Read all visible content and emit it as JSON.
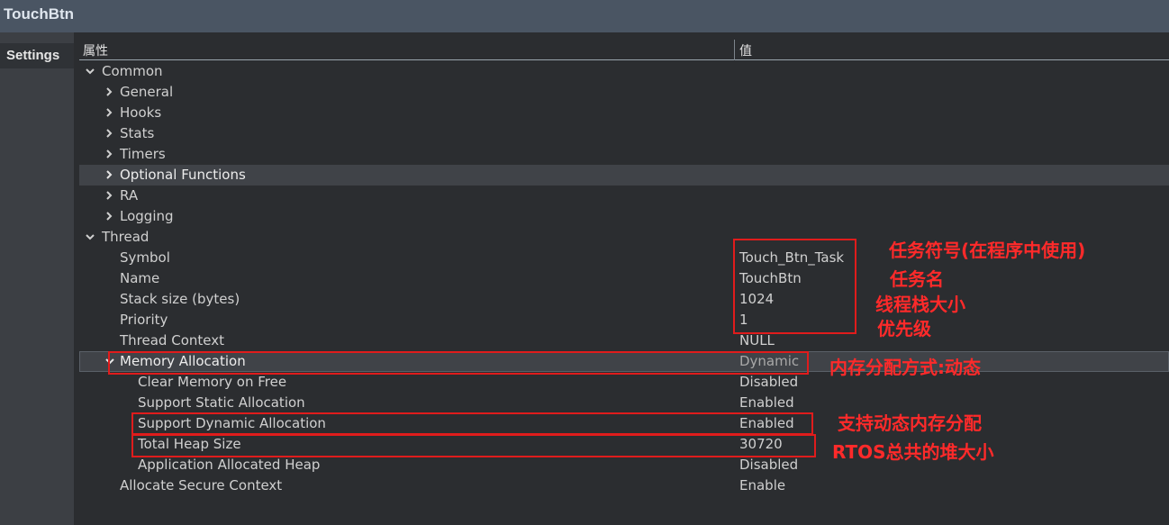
{
  "window": {
    "title": "TouchBtn"
  },
  "sidebar": {
    "tabs": [
      {
        "label": "Settings"
      }
    ]
  },
  "table": {
    "headers": {
      "property": "属性",
      "value": "值"
    },
    "rows": [
      {
        "label": "Common",
        "value": "",
        "expanded": true
      },
      {
        "label": "General",
        "value": ""
      },
      {
        "label": "Hooks",
        "value": ""
      },
      {
        "label": "Stats",
        "value": ""
      },
      {
        "label": "Timers",
        "value": ""
      },
      {
        "label": "Optional Functions",
        "value": ""
      },
      {
        "label": "RA",
        "value": ""
      },
      {
        "label": "Logging",
        "value": ""
      },
      {
        "label": "Thread",
        "value": "",
        "expanded": true
      },
      {
        "label": "Symbol",
        "value": "Touch_Btn_Task"
      },
      {
        "label": "Name",
        "value": "TouchBtn"
      },
      {
        "label": "Stack size (bytes)",
        "value": "1024"
      },
      {
        "label": "Priority",
        "value": "1"
      },
      {
        "label": "Thread Context",
        "value": "NULL"
      },
      {
        "label": "Memory Allocation",
        "value": "Dynamic",
        "expanded": true
      },
      {
        "label": "Clear Memory on Free",
        "value": "Disabled"
      },
      {
        "label": "Support Static Allocation",
        "value": "Enabled"
      },
      {
        "label": "Support Dynamic Allocation",
        "value": "Enabled"
      },
      {
        "label": "Total Heap Size",
        "value": "30720"
      },
      {
        "label": "Application Allocated Heap",
        "value": "Disabled"
      },
      {
        "label": "Allocate Secure Context",
        "value": "Enable"
      }
    ]
  },
  "annotations": {
    "symbol_note": "任务符号(在程序中使用)",
    "name_note": "任务名",
    "stack_note": "线程栈大小",
    "priority_note": "优先级",
    "memory_note": "内存分配方式:动态",
    "dynamic_note": "支持动态内存分配",
    "heap_note": "RTOS总共的堆大小"
  },
  "colors": {
    "annotation": "#e01c1c",
    "titlebar": "#4a5563",
    "background": "#2b2d30"
  }
}
